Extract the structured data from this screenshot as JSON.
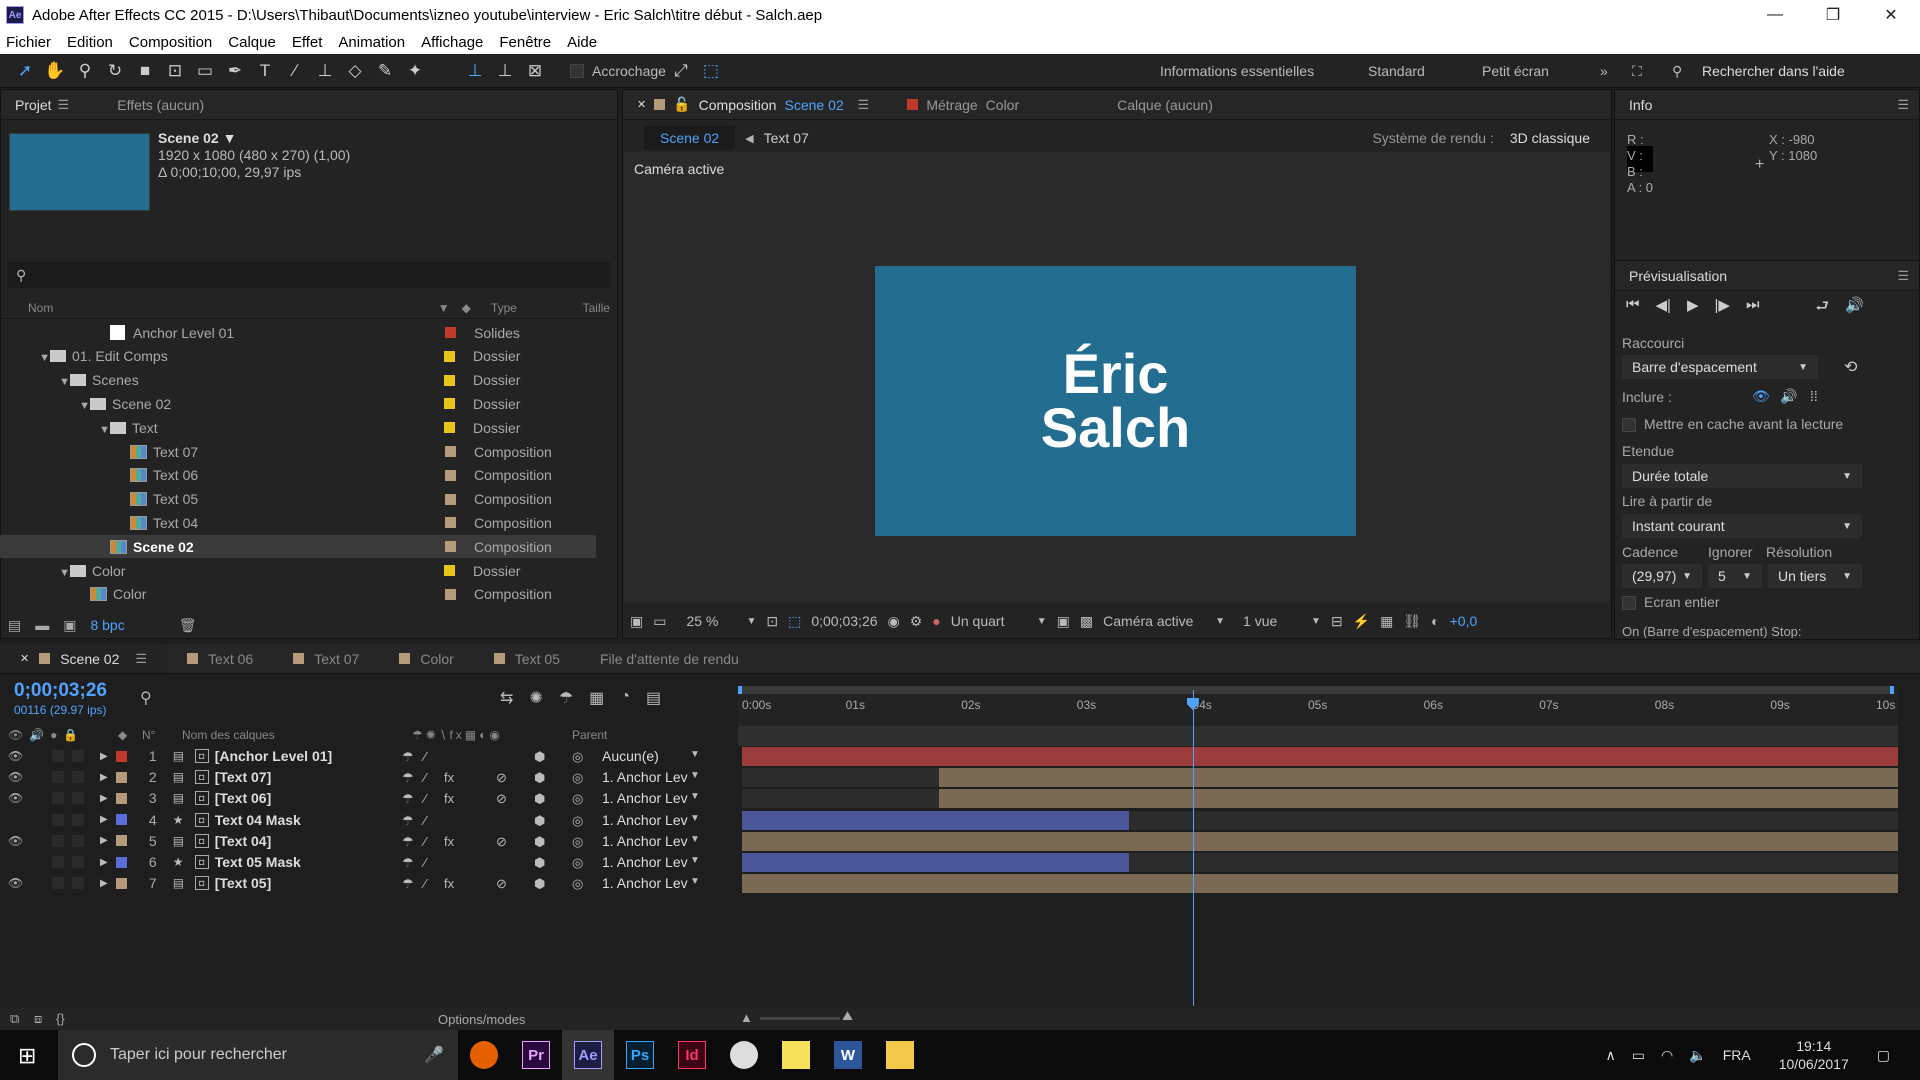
{
  "window": {
    "title": "Adobe After Effects CC 2015 - D:\\Users\\Thibaut\\Documents\\izneo youtube\\interview - Eric Salch\\titre début - Salch.aep",
    "app_badge": "Ae"
  },
  "menu": [
    "Fichier",
    "Edition",
    "Composition",
    "Calque",
    "Effet",
    "Animation",
    "Affichage",
    "Fenêtre",
    "Aide"
  ],
  "toolbar": {
    "snapping": "Accrochage",
    "workspaces": [
      "Informations essentielles",
      "Standard",
      "Petit écran"
    ],
    "help_search": "Rechercher dans l'aide"
  },
  "project": {
    "tabs": [
      "Projet",
      "Effets  (aucun)"
    ],
    "item_name": "Scene 02 ▼",
    "item_info": [
      "1920 x 1080  (480 x 270) (1,00)",
      "Δ 0;00;10;00, 29,97 ips"
    ],
    "columns": [
      "Nom",
      "Type",
      "Taille"
    ],
    "rows": [
      {
        "name": "Anchor Level 01",
        "type": "Solides",
        "color": "#c0392b"
      },
      {
        "name": "01. Edit Comps",
        "type": "Dossier",
        "color": "#e6c619"
      },
      {
        "name": "Scenes",
        "type": "Dossier",
        "color": "#e6c619"
      },
      {
        "name": "Scene 02",
        "type": "Dossier",
        "color": "#e6c619"
      },
      {
        "name": "Text",
        "type": "Dossier",
        "color": "#e6c619"
      },
      {
        "name": "Text 07",
        "type": "Composition",
        "color": "#b59b79"
      },
      {
        "name": "Text 06",
        "type": "Composition",
        "color": "#b59b79"
      },
      {
        "name": "Text 05",
        "type": "Composition",
        "color": "#b59b79"
      },
      {
        "name": "Text 04",
        "type": "Composition",
        "color": "#b59b79"
      },
      {
        "name": "Scene 02",
        "type": "Composition",
        "color": "#b59b79"
      },
      {
        "name": "Color",
        "type": "Dossier",
        "color": "#e6c619"
      },
      {
        "name": "Color",
        "type": "Composition",
        "color": "#b59b79"
      }
    ],
    "bpc": "8 bpc"
  },
  "comp": {
    "tab_prefix": "Composition",
    "tab_comp": "Scene 02",
    "footage_tab": "Métrage",
    "footage_name": "Color",
    "layer_tab": "Calque  (aucun)",
    "breadcrumb": [
      "Scene 02",
      "Text 07"
    ],
    "renderer_label": "Système de rendu :",
    "renderer": "3D  classique",
    "camera_label": "Caméra active",
    "title_line1": "Éric",
    "title_line2": "Salch",
    "zoom": "25 %",
    "timecode": "0;00;03;26",
    "resolution": "Un quart",
    "camera": "Caméra active",
    "views": "1 vue",
    "exposure": "+0,0"
  },
  "info": {
    "title": "Info",
    "r": "R :",
    "v": "V :",
    "b": "B :",
    "a": "A : 0",
    "x": "X : -980",
    "y": "Y : 1080"
  },
  "preview": {
    "title": "Prévisualisation",
    "shortcut_label": "Raccourci",
    "shortcut": "Barre d'espacement",
    "include_label": "Inclure :",
    "cache_label": "Mettre en cache avant la lecture",
    "range_label": "Etendue",
    "range": "Durée totale",
    "play_from_label": "Lire à partir de",
    "play_from": "Instant courant",
    "fps_label": "Cadence",
    "skip_label": "Ignorer",
    "res_label": "Résolution",
    "fps": "(29,97)",
    "skip": "5",
    "res": "Un tiers",
    "fullscreen_label": "Ecran entier",
    "footer": "On (Barre d'espacement) Stop:"
  },
  "timeline": {
    "tabs": [
      "Scene 02",
      "Text 06",
      "Text 07",
      "Color",
      "Text 05",
      "File d'attente de rendu"
    ],
    "tab_colors": [
      "#b59b79",
      "#b59b79",
      "#b59b79",
      "#b59b79",
      "#b59b79"
    ],
    "timecode": "0;00;03;26",
    "frame_info": "00116 (29.97 ips)",
    "col_num": "N°",
    "col_name": "Nom des calques",
    "col_parent": "Parent",
    "ruler": [
      "0:00s",
      "01s",
      "02s",
      "03s",
      "04s",
      "05s",
      "06s",
      "07s",
      "08s",
      "09s",
      "10s"
    ],
    "current_time_seconds": 3.9,
    "layers": [
      {
        "num": "1",
        "name": "[Anchor Level 01]",
        "parent": "Aucun(e)",
        "color": "#c0392b",
        "fx": "",
        "bar_start": 0,
        "bar_end": 10,
        "bar_color": "#9b3b3b"
      },
      {
        "num": "2",
        "name": "[Text 07]",
        "parent": "1. Anchor Lev",
        "color": "#b59b79",
        "fx": "fx",
        "bar_start": 1.7,
        "bar_end": 10,
        "bar_color": "#7a6a55"
      },
      {
        "num": "3",
        "name": "[Text 06]",
        "parent": "1. Anchor Lev",
        "color": "#b59b79",
        "fx": "fx",
        "bar_start": 1.7,
        "bar_end": 10,
        "bar_color": "#7a6a55"
      },
      {
        "num": "4",
        "name": "Text 04 Mask",
        "parent": "1. Anchor Lev",
        "color": "#5a6dd8",
        "fx": "",
        "bar_start": 0,
        "bar_end": 3.35,
        "bar_color": "#4b559a"
      },
      {
        "num": "5",
        "name": "[Text 04]",
        "parent": "1. Anchor Lev",
        "color": "#b59b79",
        "fx": "fx",
        "bar_start": 0,
        "bar_end": 10,
        "bar_color": "#7a6a55"
      },
      {
        "num": "6",
        "name": "Text 05 Mask",
        "parent": "1. Anchor Lev",
        "color": "#5a6dd8",
        "fx": "",
        "bar_start": 0,
        "bar_end": 3.35,
        "bar_color": "#4b559a"
      },
      {
        "num": "7",
        "name": "[Text 05]",
        "parent": "1. Anchor Lev",
        "color": "#b59b79",
        "fx": "fx",
        "bar_start": 0,
        "bar_end": 10,
        "bar_color": "#7a6a55"
      }
    ],
    "footer": "Options/modes"
  },
  "taskbar": {
    "search": "Taper ici pour rechercher",
    "apps": [
      "Firefox",
      "Pr",
      "Ae",
      "Ps",
      "Id",
      "Paint",
      "Notes",
      "W",
      "Explorer"
    ],
    "lang": "FRA",
    "time": "19:14",
    "date": "10/06/2017"
  }
}
